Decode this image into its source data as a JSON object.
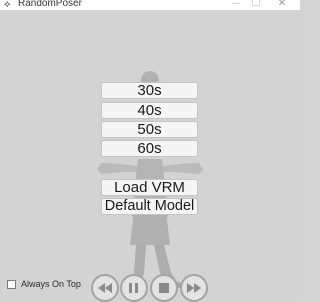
{
  "window": {
    "title": "RandomPoser",
    "app_icon": "app-logo-icon",
    "controls": {
      "minimize": "—",
      "maximize": "☐",
      "close": "✕"
    }
  },
  "menu": {
    "buttons": [
      "30s",
      "40s",
      "50s",
      "60s"
    ],
    "load_vrm": "Load VRM",
    "default_model": "Default Model"
  },
  "options": {
    "always_on_top": {
      "label": "Always On Top",
      "checked": false
    }
  },
  "media_controls": {
    "icons": [
      "rewind-icon",
      "pause-icon",
      "stop-icon",
      "fast-forward-icon"
    ]
  },
  "colors": {
    "background": "#d3d3d3",
    "button_face": "#f5f5f5",
    "button_border": "#c4c4c4",
    "media_button": "#e3e3e3"
  }
}
